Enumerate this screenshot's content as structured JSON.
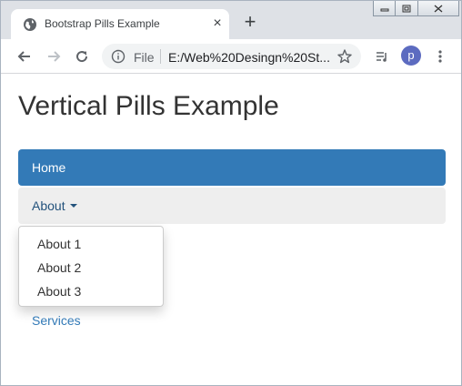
{
  "browser": {
    "tab_title": "Bootstrap Pills Example",
    "tab_close": "×",
    "new_tab": "+",
    "address": {
      "scheme_label": "File",
      "url": "E:/Web%20Desingn%20St..."
    },
    "profile_initial": "p"
  },
  "page": {
    "title": "Vertical Pills Example",
    "pills": {
      "home": "Home",
      "about": "About",
      "services": "Services"
    },
    "dropdown": [
      "About 1",
      "About 2",
      "About 3"
    ]
  },
  "colors": {
    "active_pill": "#337ab7",
    "open_pill_bg": "#eeeeee",
    "link": "#337ab7"
  }
}
